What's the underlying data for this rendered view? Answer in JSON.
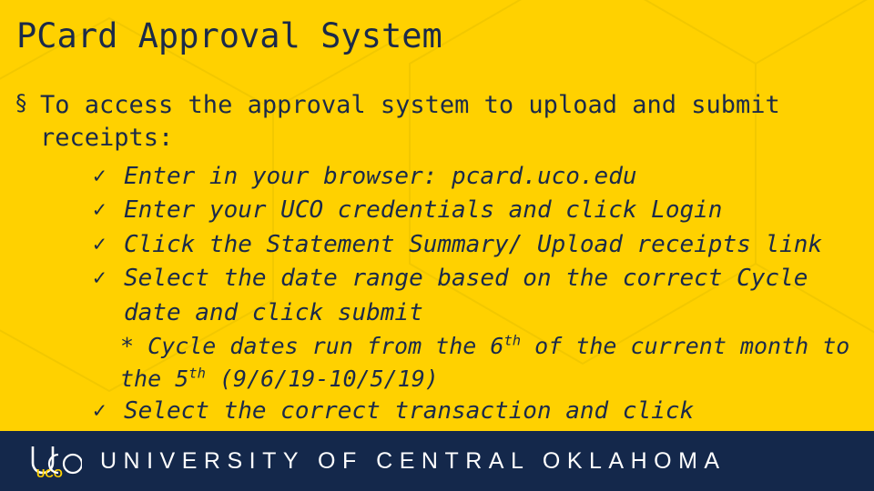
{
  "slide": {
    "title": "PCard Approval System",
    "colors": {
      "background": "#FFD100",
      "text": "#1b2a49",
      "footer_band": "#14284B",
      "footer_text": "#ffffff"
    },
    "level1": {
      "bullet": "section-bullet",
      "text": "To access the approval system to upload and submit receipts:"
    },
    "level2_items": [
      {
        "bullet": "checkmark",
        "text": "Enter in your browser: pcard.uco.edu"
      },
      {
        "bullet": "checkmark",
        "text": "Enter your UCO credentials and click Login"
      },
      {
        "bullet": "checkmark",
        "text": "Click the Statement Summary/ Upload receipts link"
      },
      {
        "bullet": "checkmark",
        "text": "Select the date range based on the correct Cycle date and click submit"
      }
    ],
    "level3_items": [
      {
        "prefix": "* Cycle dates run from the ",
        "sup1": "th",
        "sup1_num": "6",
        "middle": " of the current month to the ",
        "sup2_num": "5",
        "sup2": "th",
        "suffix": " (9/6/19-10/5/19)"
      }
    ],
    "clipped_line": "Select the correct transaction and click"
  },
  "footer": {
    "logo": "uco-logo",
    "text": "UNIVERSITY OF CENTRAL OKLAHOMA"
  }
}
